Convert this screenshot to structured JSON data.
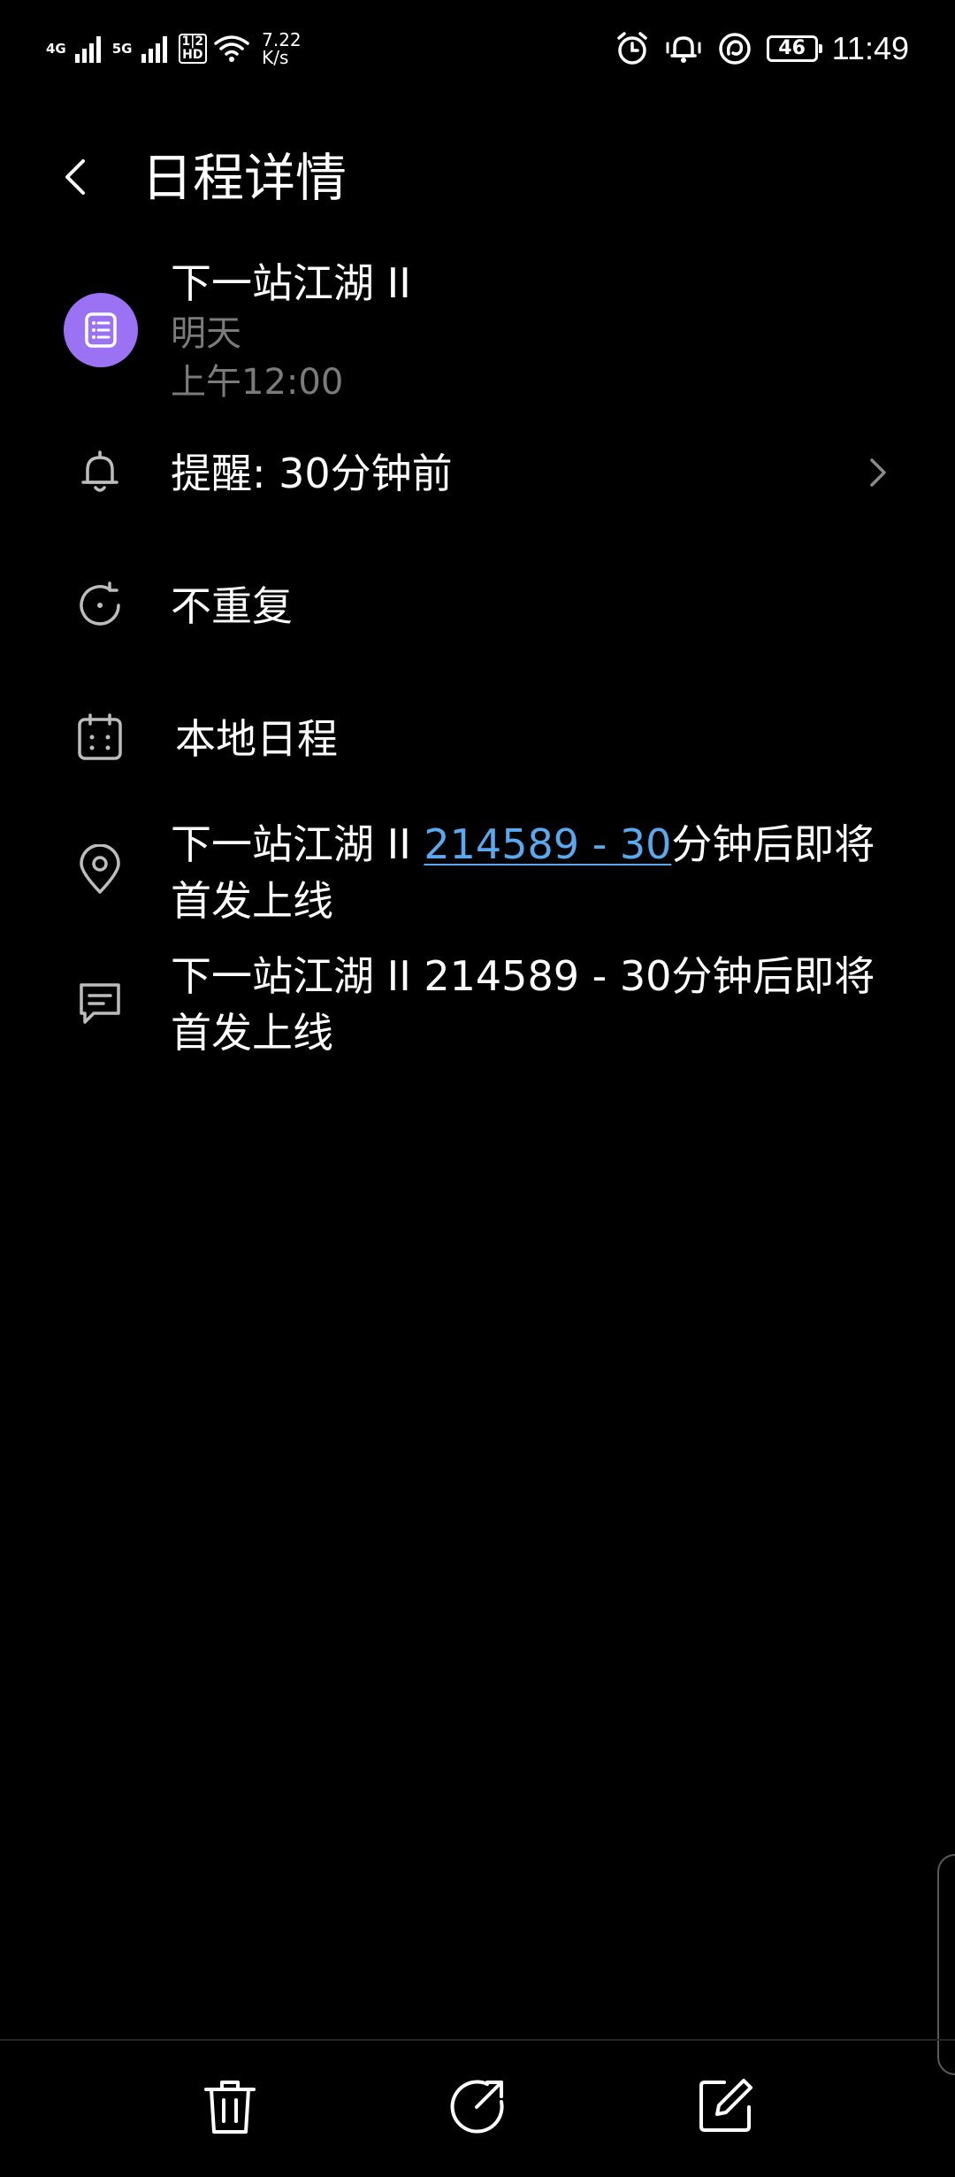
{
  "status_bar": {
    "net1": "4G",
    "net2": "5G",
    "hd_top": "1|2",
    "hd_bottom": "HD",
    "speed_value": "7.22",
    "speed_unit": "K/s",
    "battery": "46",
    "time": "11:49",
    "icons": [
      "signal-icon",
      "signal-icon",
      "hd-icon",
      "wifi-icon",
      "alarm-icon",
      "vibrate-icon",
      "nfc-icon",
      "battery-icon"
    ]
  },
  "header": {
    "title": "日程详情",
    "back_icon": "chevron-left-icon"
  },
  "event": {
    "title": "下一站江湖 II",
    "date": "明天",
    "time": "上午12:00",
    "icon": "list-icon",
    "icon_color": "#9b72f3"
  },
  "reminder": {
    "label": "提醒: 30分钟前"
  },
  "repeat": {
    "label": "不重复"
  },
  "calendar": {
    "label": "本地日程"
  },
  "location": {
    "prefix": "下一站江湖 II ",
    "link": "214589 - 30",
    "suffix": "分钟后即将首发上线",
    "link_color": "#5aa9ee"
  },
  "notes": {
    "text": "下一站江湖 II 214589 - 30分钟后即将首发上线"
  },
  "bottom_bar": {
    "icons": [
      "trash-icon",
      "share-icon",
      "edit-icon"
    ]
  }
}
